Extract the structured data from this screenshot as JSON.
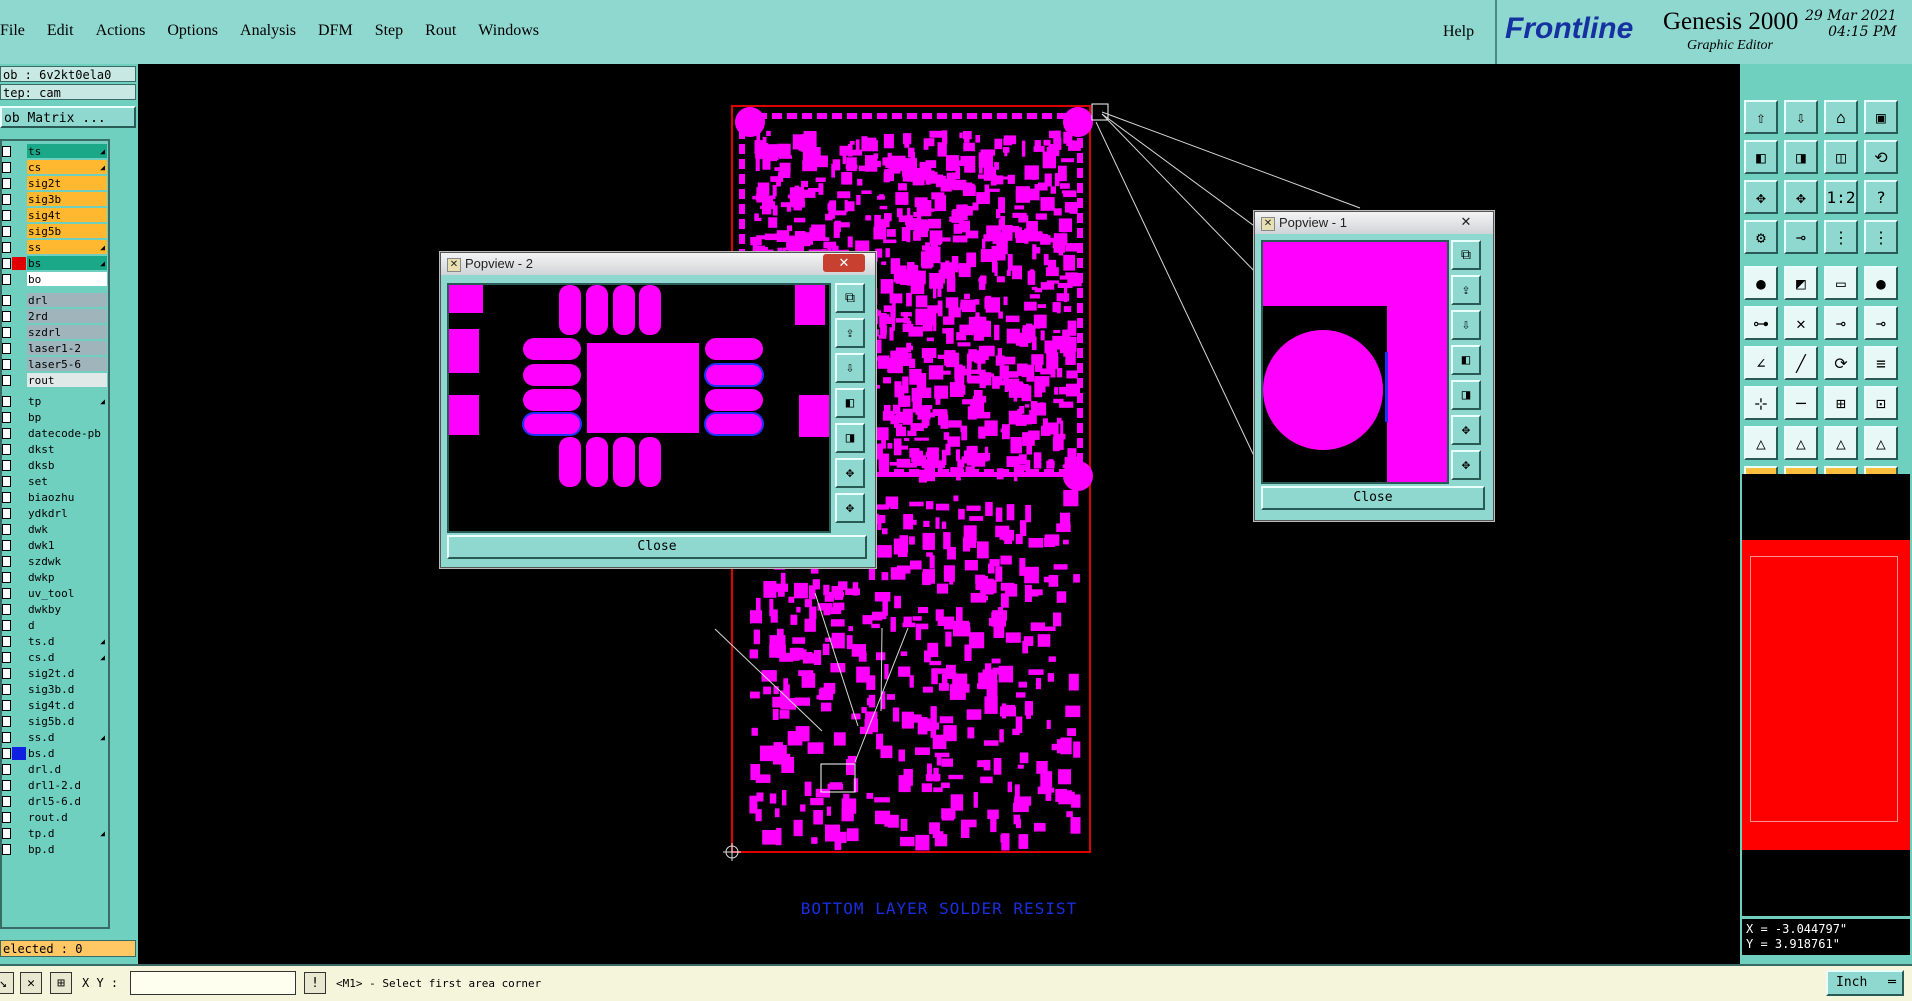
{
  "menu": {
    "items": [
      "File",
      "Edit",
      "Actions",
      "Options",
      "Analysis",
      "DFM",
      "Step",
      "Rout",
      "Windows"
    ],
    "help": "Help"
  },
  "brand": {
    "logo": "Frontline",
    "product": "Genesis 2000",
    "subtitle": "Graphic Editor",
    "date": "29 Mar 2021",
    "time": "04:15 PM"
  },
  "job": {
    "job_label": "ob : 6v2kt0ela0",
    "step_label": "tep: cam",
    "matrix_button": "ob Matrix ..."
  },
  "layers": [
    {
      "name": "ts",
      "color": "#1aa888",
      "arrow": true
    },
    {
      "name": "cs",
      "color": "#ffb830",
      "arrow": true
    },
    {
      "name": "sig2t",
      "color": "#ffb830",
      "arrow": false
    },
    {
      "name": "sig3b",
      "color": "#ffb830",
      "arrow": false
    },
    {
      "name": "sig4t",
      "color": "#ffb830",
      "arrow": false
    },
    {
      "name": "sig5b",
      "color": "#ffb830",
      "arrow": false
    },
    {
      "name": "ss",
      "color": "#ffb830",
      "arrow": true
    },
    {
      "name": "bs",
      "color": "#1aa888",
      "arrow": true,
      "swatch": "#e00000"
    },
    {
      "name": "bo",
      "color": "#ffffff",
      "arrow": false
    },
    {
      "name": "drl",
      "color": "#a0b4bc",
      "arrow": false
    },
    {
      "name": "2rd",
      "color": "#a0b4bc",
      "arrow": false
    },
    {
      "name": "szdrl",
      "color": "#a0b4bc",
      "arrow": false
    },
    {
      "name": "laser1-2",
      "color": "#a0b4bc",
      "arrow": false
    },
    {
      "name": "laser5-6",
      "color": "#a0b4bc",
      "arrow": false
    },
    {
      "name": "rout",
      "color": "#e0e8e8",
      "arrow": false
    },
    {
      "name": "tp",
      "color": "#6fd0c0",
      "arrow": true
    },
    {
      "name": "bp",
      "color": "#6fd0c0",
      "arrow": false
    },
    {
      "name": "datecode-pb",
      "color": "#6fd0c0",
      "arrow": false
    },
    {
      "name": "dkst",
      "color": "#6fd0c0",
      "arrow": false
    },
    {
      "name": "dksb",
      "color": "#6fd0c0",
      "arrow": false
    },
    {
      "name": "set",
      "color": "#6fd0c0",
      "arrow": false
    },
    {
      "name": "biaozhu",
      "color": "#6fd0c0",
      "arrow": false
    },
    {
      "name": "ydkdrl",
      "color": "#6fd0c0",
      "arrow": false
    },
    {
      "name": "dwk",
      "color": "#6fd0c0",
      "arrow": false
    },
    {
      "name": "dwk1",
      "color": "#6fd0c0",
      "arrow": false
    },
    {
      "name": "szdwk",
      "color": "#6fd0c0",
      "arrow": false
    },
    {
      "name": "dwkp",
      "color": "#6fd0c0",
      "arrow": false
    },
    {
      "name": "uv_tool",
      "color": "#6fd0c0",
      "arrow": false
    },
    {
      "name": "dwkby",
      "color": "#6fd0c0",
      "arrow": false
    },
    {
      "name": "d",
      "color": "#6fd0c0",
      "arrow": false
    },
    {
      "name": "ts.d",
      "color": "#6fd0c0",
      "arrow": true
    },
    {
      "name": "cs.d",
      "color": "#6fd0c0",
      "arrow": true
    },
    {
      "name": "sig2t.d",
      "color": "#6fd0c0",
      "arrow": false
    },
    {
      "name": "sig3b.d",
      "color": "#6fd0c0",
      "arrow": false
    },
    {
      "name": "sig4t.d",
      "color": "#6fd0c0",
      "arrow": false
    },
    {
      "name": "sig5b.d",
      "color": "#6fd0c0",
      "arrow": false
    },
    {
      "name": "ss.d",
      "color": "#6fd0c0",
      "arrow": true
    },
    {
      "name": "bs.d",
      "color": "#6fd0c0",
      "arrow": false,
      "swatch": "#1020e0"
    },
    {
      "name": "drl.d",
      "color": "#6fd0c0",
      "arrow": false
    },
    {
      "name": "drl1-2.d",
      "color": "#6fd0c0",
      "arrow": false
    },
    {
      "name": "drl5-6.d",
      "color": "#6fd0c0",
      "arrow": false
    },
    {
      "name": "rout.d",
      "color": "#6fd0c0",
      "arrow": false
    },
    {
      "name": "tp.d",
      "color": "#6fd0c0",
      "arrow": true
    },
    {
      "name": "bp.d",
      "color": "#6fd0c0",
      "arrow": false
    }
  ],
  "selected": "elected : 0",
  "canvas": {
    "layer_caption": "BOTTOM LAYER SOLDER RESIST",
    "feature_color": "#ff00ff",
    "profile_color": "#e00000"
  },
  "popview1": {
    "title": "Popview - 1",
    "close_label": "Close"
  },
  "popview2": {
    "title": "Popview - 2",
    "close_label": "Close"
  },
  "coords": {
    "x": "X = -3.044797\"",
    "y": "Y = 3.918761\""
  },
  "bottom": {
    "xy_label": "X Y :",
    "xy_value": "",
    "prompt": "<M1> - Select first area corner",
    "units": "Inch"
  }
}
